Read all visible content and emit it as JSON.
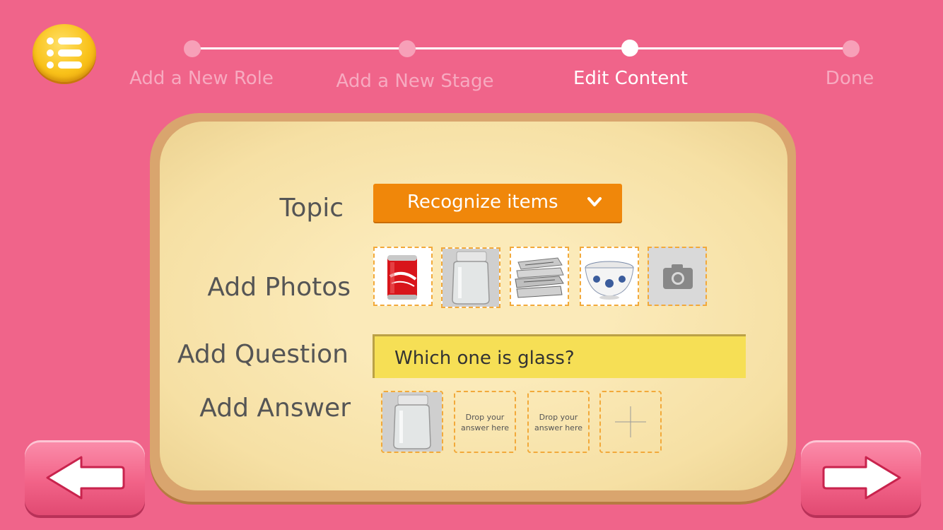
{
  "app": {
    "menu_icon": "list-menu-icon"
  },
  "steps": [
    {
      "label": "Add a New Role",
      "state": "inactive"
    },
    {
      "label": "Add a New Stage",
      "state": "inactive"
    },
    {
      "label": "Edit Content",
      "state": "active"
    },
    {
      "label": "Done",
      "state": "inactive"
    }
  ],
  "form": {
    "topic_label": "Topic",
    "topic_value": "Recognize items",
    "photos_label": "Add Photos",
    "photos": [
      {
        "name": "coca-cola-can-photo"
      },
      {
        "name": "glass-jar-photo"
      },
      {
        "name": "newspaper-stack-photo"
      },
      {
        "name": "porcelain-bowl-photo"
      }
    ],
    "camera_icon": "camera-icon",
    "question_label": "Add Question",
    "question_value": "Which one is glass?",
    "answer_label": "Add Answer",
    "answers": [
      {
        "type": "photo",
        "name": "glass-jar-photo"
      },
      {
        "type": "drop",
        "text": "Drop your answer here"
      },
      {
        "type": "drop",
        "text": "Drop your answer here"
      },
      {
        "type": "add",
        "icon": "plus-icon"
      }
    ]
  },
  "nav": {
    "back_icon": "arrow-left-icon",
    "next_icon": "arrow-right-icon"
  },
  "colors": {
    "background": "#f0648a",
    "topic_select": "#f0870a",
    "question_field": "#f6df55",
    "board": "#fbeab9"
  }
}
